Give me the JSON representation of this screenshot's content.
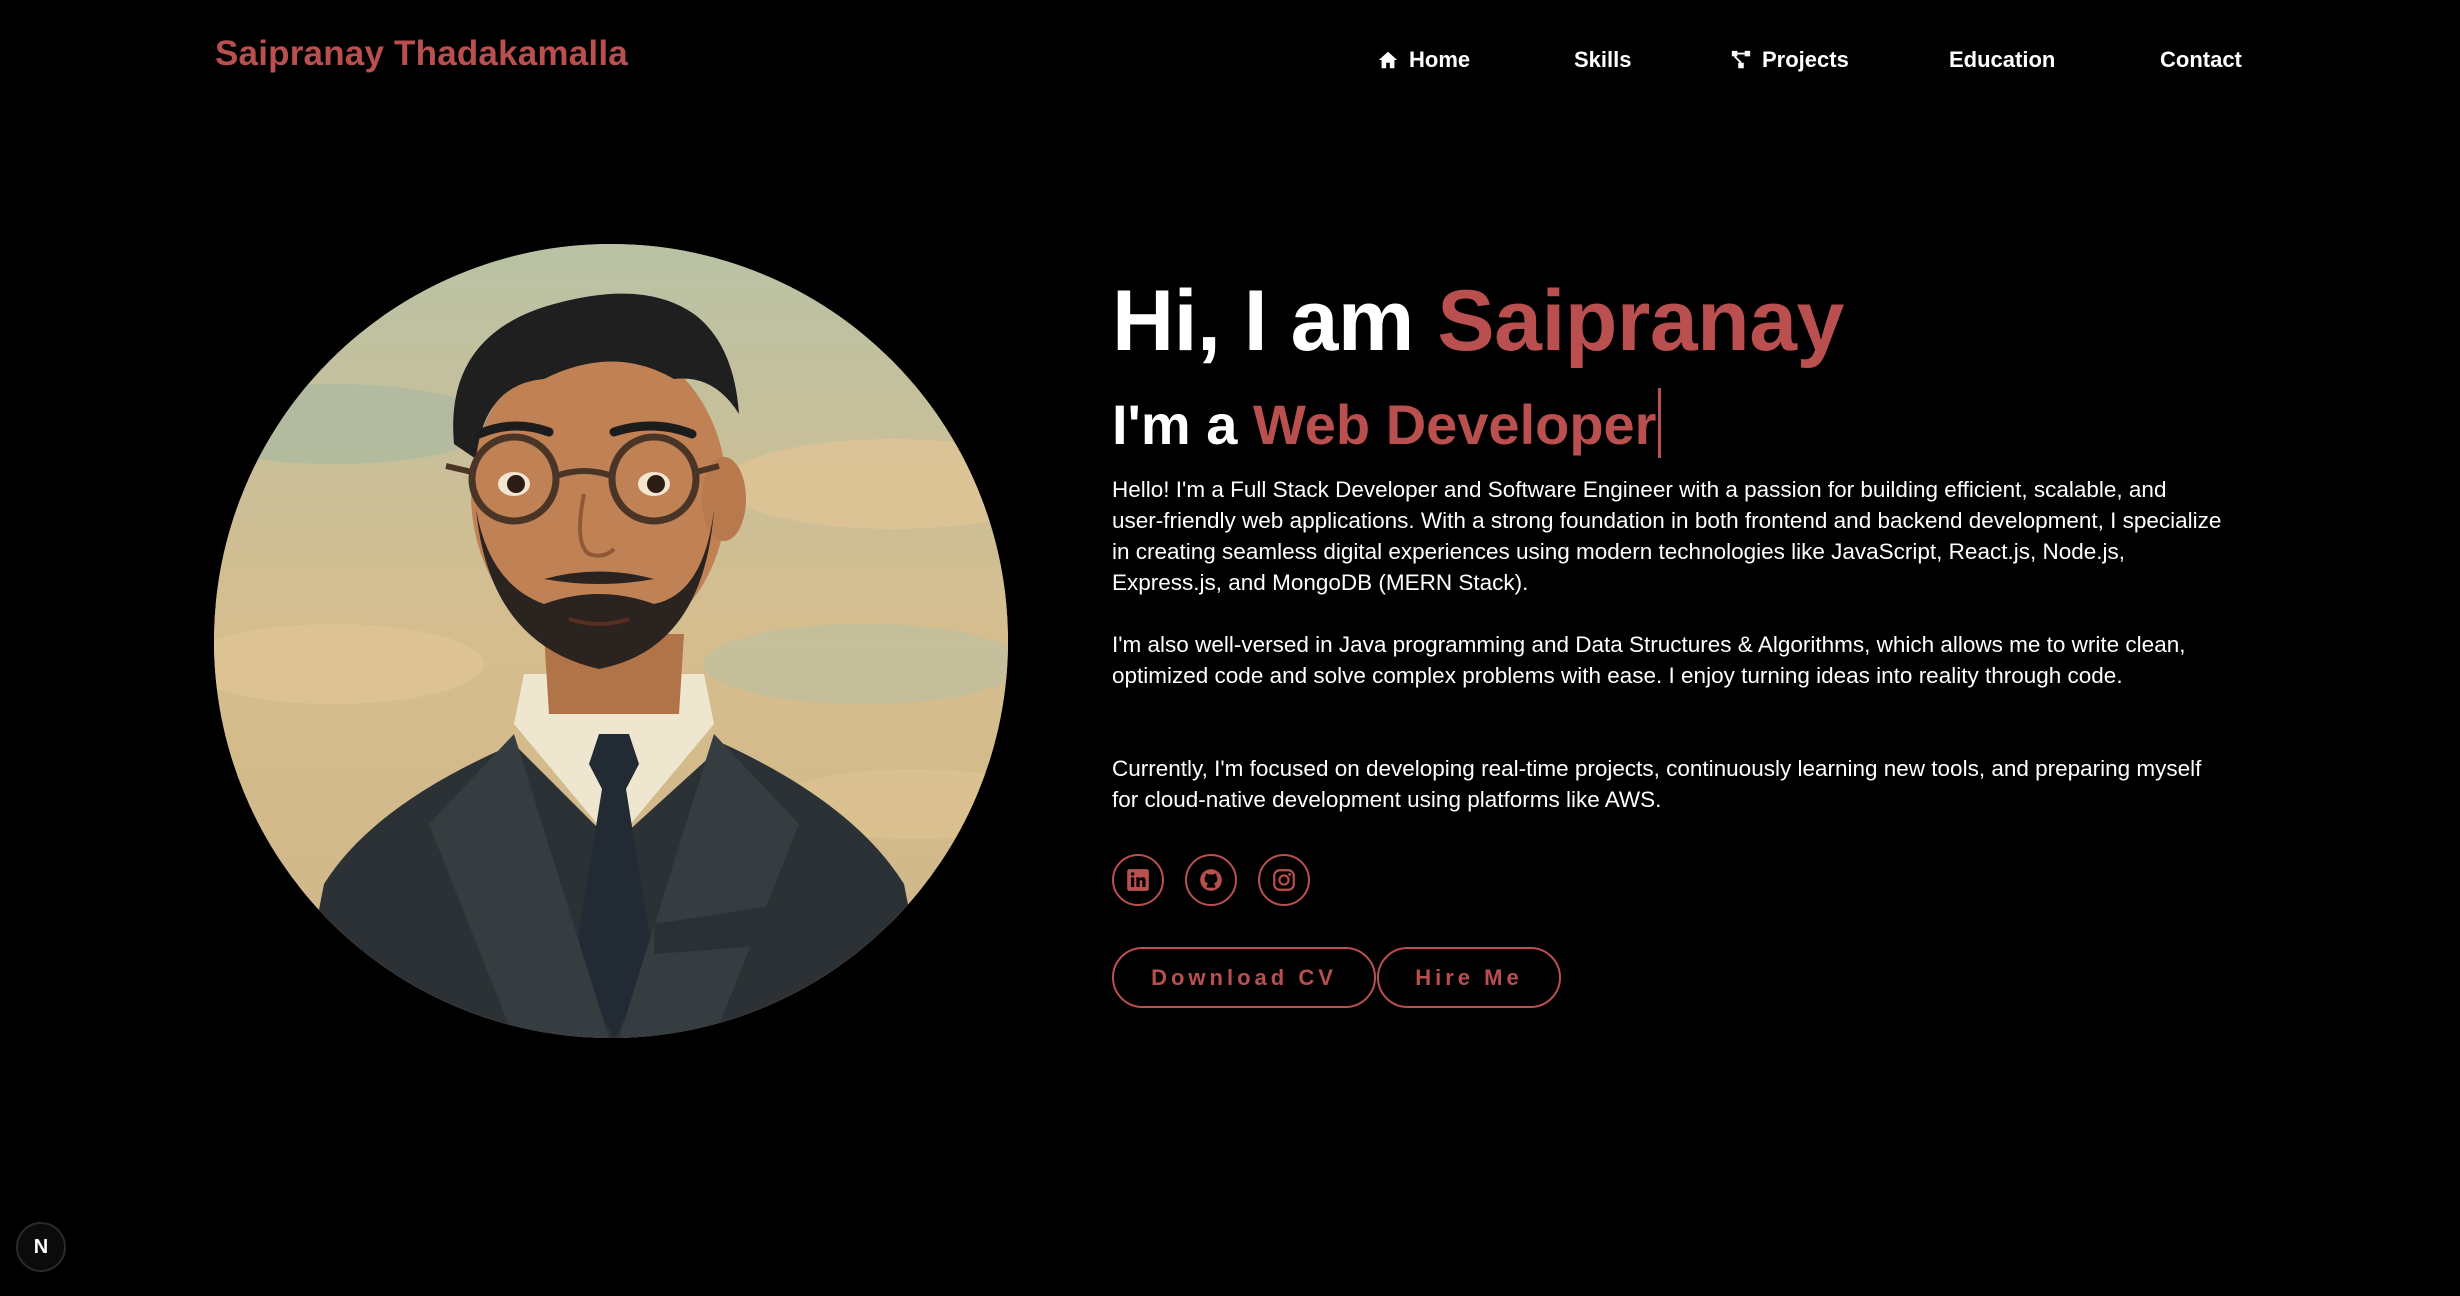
{
  "header": {
    "brand": "Saipranay Thadakamalla",
    "nav": [
      {
        "label": "Home",
        "icon": "home-icon"
      },
      {
        "label": "Skills",
        "icon": ""
      },
      {
        "label": "Projects",
        "icon": "nodes-icon"
      },
      {
        "label": "Education",
        "icon": ""
      },
      {
        "label": "Contact",
        "icon": ""
      }
    ]
  },
  "hero": {
    "greeting": "Hi, I am ",
    "name": "Saipranay",
    "role_prefix": "I'm a ",
    "role": "Web Developer",
    "paragraphs": [
      "Hello! I'm a Full Stack Developer and Software Engineer with a passion for building efficient, scalable, and user-friendly web applications. With a strong foundation in both frontend and backend development, I specialize in creating seamless digital experiences using modern technologies like JavaScript, React.js, Node.js, Express.js, and MongoDB (MERN Stack).",
      "I'm also well-versed in Java programming and Data Structures & Algorithms, which allows me to write clean, optimized code and solve complex problems with ease. I enjoy turning ideas into reality through code.",
      "Currently, I'm focused on developing real-time projects, continuously learning new tools, and preparing myself for cloud-native development using platforms like AWS."
    ],
    "socials": [
      "linkedin-icon",
      "github-icon",
      "instagram-icon"
    ],
    "buttons": {
      "download": "Download CV",
      "hire": "Hire Me"
    }
  },
  "badge": {
    "label": "N"
  },
  "colors": {
    "background": "#000000",
    "accent": "#b94f4f",
    "text": "#ffffff"
  }
}
